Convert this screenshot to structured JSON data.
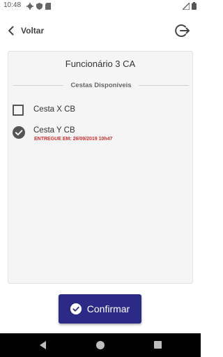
{
  "status_bar": {
    "time": "10:48",
    "left_icons": [
      "gear-icon",
      "shield-icon",
      "sim-card-icon"
    ],
    "right_icons": [
      "signal-icon",
      "battery-icon"
    ]
  },
  "header": {
    "back_label": "Voltar",
    "back_icon": "chevron-left-icon",
    "logout_icon": "logout-icon"
  },
  "card": {
    "title": "Funcionário 3 CA",
    "section_label": "Cestas Disponíveis",
    "items": [
      {
        "label": "Cesta X CB",
        "checked": false,
        "note": ""
      },
      {
        "label": "Cesta Y CB",
        "checked": true,
        "note": "ENTREGUE EM: 26/09/2019 10h47"
      }
    ]
  },
  "confirm": {
    "label": "Confirmar",
    "icon": "check-circle-icon"
  },
  "colors": {
    "primary": "#2b2a86",
    "alert": "#d32f2f",
    "card_bg": "#f5f5f5"
  },
  "nav_bar": {
    "buttons": [
      "back-triangle-icon",
      "home-circle-icon",
      "recents-square-icon"
    ]
  }
}
